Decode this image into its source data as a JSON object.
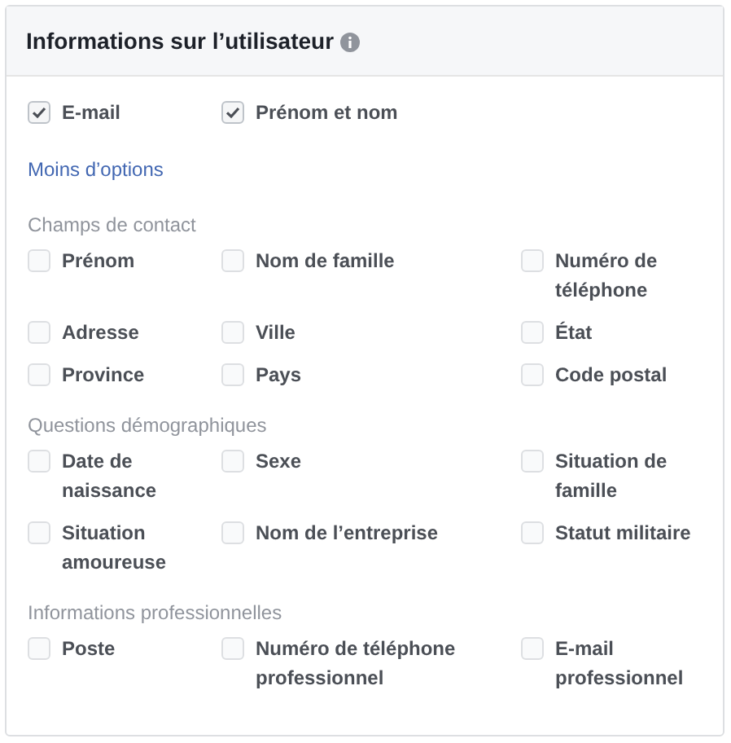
{
  "panel": {
    "title": "Informations sur l’utilisateur"
  },
  "default_fields": [
    {
      "label": "E-mail",
      "checked": true
    },
    {
      "label": "Prénom et nom",
      "checked": true
    }
  ],
  "toggle_link": "Moins d’options",
  "sections": [
    {
      "heading": "Champs de contact",
      "options": [
        {
          "label": "Prénom",
          "checked": false
        },
        {
          "label": "Nom de famille",
          "checked": false
        },
        {
          "label": "Numéro de téléphone",
          "checked": false
        },
        {
          "label": "Adresse",
          "checked": false
        },
        {
          "label": "Ville",
          "checked": false
        },
        {
          "label": "État",
          "checked": false
        },
        {
          "label": "Province",
          "checked": false
        },
        {
          "label": "Pays",
          "checked": false
        },
        {
          "label": "Code postal",
          "checked": false
        }
      ]
    },
    {
      "heading": "Questions démographiques",
      "options": [
        {
          "label": "Date de naissance",
          "checked": false
        },
        {
          "label": "Sexe",
          "checked": false
        },
        {
          "label": "Situation de famille",
          "checked": false
        },
        {
          "label": "Situation amoureuse",
          "checked": false
        },
        {
          "label": "Nom de l’entreprise",
          "checked": false
        },
        {
          "label": "Statut militaire",
          "checked": false
        }
      ]
    },
    {
      "heading": "Informations professionnelles",
      "options": [
        {
          "label": "Poste",
          "checked": false
        },
        {
          "label": "Numéro de téléphone professionnel",
          "checked": false
        },
        {
          "label": "E-mail professionnel",
          "checked": false
        }
      ]
    }
  ]
}
